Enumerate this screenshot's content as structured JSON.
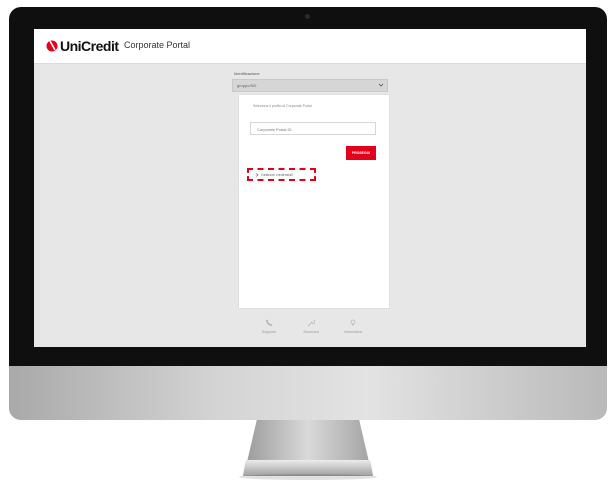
{
  "header": {
    "brand": "UniCredit",
    "portal_title": "Corporate Portal"
  },
  "login": {
    "select_label": "Identificazione",
    "select_value": "gruppo/ND",
    "card_hint": "Seleziona il profilo di Corporate Portal",
    "input_value": "Corporate Portal ID",
    "submit_label": "PROSEGUI",
    "highlighted_link": "Gestione credenziali"
  },
  "footer": {
    "items": [
      {
        "label": "Supporto",
        "icon": "phone-icon"
      },
      {
        "label": "Sicurezza",
        "icon": "wrench-icon"
      },
      {
        "label": "Informativa",
        "icon": "lightbulb-icon"
      }
    ]
  },
  "colors": {
    "brand_red": "#e2001a",
    "screen_bg": "#e7e7e7",
    "bezel": "#0f0f0f"
  }
}
